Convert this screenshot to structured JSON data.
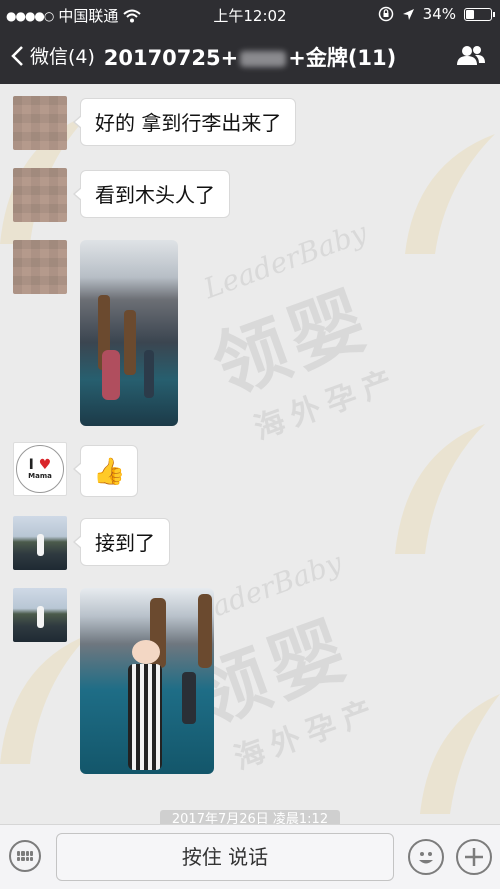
{
  "status_bar": {
    "signal_dots": "●●●●○",
    "carrier": "中国联通",
    "time": "上午12:02",
    "battery_percent": "34%",
    "battery_level": 0.34,
    "icons": [
      "wifi-icon",
      "rotation-lock-icon",
      "location-arrow-icon",
      "battery-icon"
    ]
  },
  "nav": {
    "back_label": "微信(4)",
    "title_prefix": "20170725+",
    "title_suffix": "+金牌(11)",
    "right_icon": "group-members-icon"
  },
  "watermark": {
    "brand_en": "LeaderBaby",
    "brand_cn": "领婴",
    "slogan_cn": "海外孕产"
  },
  "messages": [
    {
      "type": "text",
      "text": "好的 拿到行李出来了",
      "avatar": "mosaic-avatar"
    },
    {
      "type": "text",
      "text": "看到木头人了",
      "avatar": "mosaic-avatar"
    },
    {
      "type": "image",
      "avatar": "mosaic-avatar"
    },
    {
      "type": "emoji",
      "text": "👍",
      "avatar": "i-love-mama-avatar",
      "avatar_line": "I",
      "avatar_heart": "♥",
      "avatar_sub": "Mama"
    },
    {
      "type": "text",
      "text": "接到了",
      "avatar": "sea-avatar"
    },
    {
      "type": "image",
      "avatar": "sea-avatar"
    }
  ],
  "date_divider": "2017年7月26日 凌晨1:12",
  "input_bar": {
    "hold_to_talk": "按住 说话",
    "icons": [
      "keyboard-icon",
      "emoji-icon",
      "plus-icon"
    ]
  },
  "colors": {
    "bar_bg": "#2e2e32",
    "chat_bg": "#ebebeb",
    "bubble_bg": "#ffffff",
    "watermark_gold": "#e6c878"
  }
}
